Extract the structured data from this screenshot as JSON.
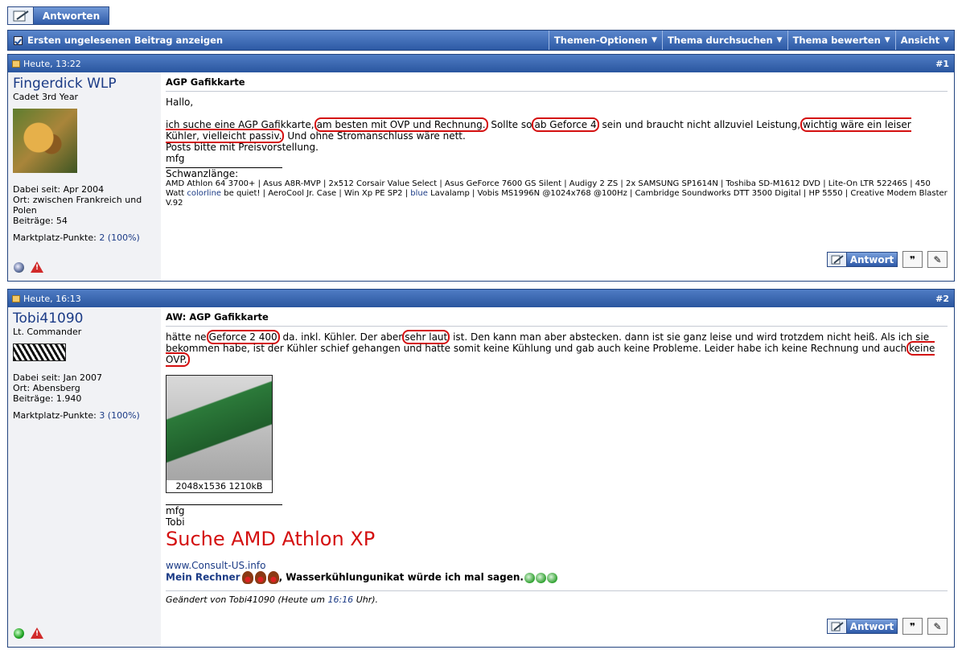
{
  "top": {
    "reply_label": "Antworten"
  },
  "toolbar": {
    "first_unread": "Ersten ungelesenen Beitrag anzeigen",
    "menus": [
      "Themen-Optionen",
      "Thema durchsuchen",
      "Thema bewerten",
      "Ansicht"
    ]
  },
  "post1": {
    "date": "Heute, 13:22",
    "number": "#1",
    "user": {
      "name": "Fingerdick WLP",
      "title": "Cadet 3rd Year",
      "joined": "Dabei seit: Apr 2004",
      "location": "Ort: zwischen Frankreich und Polen",
      "posts": "Beiträge: 54",
      "market_label": "Marktplatz-Punkte:",
      "market_value": "2 (100%)"
    },
    "title": "AGP Gafikkarte",
    "greeting": "Hallo,",
    "body": {
      "t1": "ich suche eine AGP Gafikkarte,",
      "c1": "am besten mit OVP und Rechnung.",
      "t2": "Sollte so",
      "c2": "ab Geforce 4",
      "t3": "sein und braucht nicht allzuviel Leistung,",
      "c3": "wichtig wäre ein leiser Kühler, vielleicht passiv.",
      "t4": "Und ohne Stromanschluss wäre nett."
    },
    "line2": "Posts bitte mit Preisvorstellung.",
    "line3": "mfg",
    "sig_label": "Schwanzlänge:",
    "sig_text_a": "AMD Athlon 64 3700+ | Asus A8R-MVP | 2x512 Corsair Value Select | Asus GeForce 7600 GS Silent | Audigy 2 ZS | 2x SAMSUNG SP1614N | Toshiba SD-M1612 DVD | Lite-On LTR 52246S | 450 Watt",
    "sig_colorline": "colorline",
    "sig_text_b": "be quiet! | AeroCool Jr. Case | Win Xp PE SP2 |",
    "sig_blue": "blue",
    "sig_text_c": "Lavalamp | Vobis MS1996N @1024x768 @100Hz | Cambridge Soundworks DTT 3500 Digital | HP 5550 | Creative Modem Blaster V.92",
    "btn_reply": "Antwort"
  },
  "post2": {
    "date": "Heute, 16:13",
    "number": "#2",
    "user": {
      "name": "Tobi41090",
      "title": "Lt. Commander",
      "joined": "Dabei seit: Jan 2007",
      "location": "Ort: Abensberg",
      "posts": "Beiträge: 1.940",
      "market_label": "Marktplatz-Punkte:",
      "market_value": "3 (100%)"
    },
    "title": "AW: AGP Gafikkarte",
    "body": {
      "t1": "hätte ne",
      "c1": "Geforce 2 400",
      "t2": "da. inkl. Kühler. Der aber",
      "c2": "sehr laut",
      "t3": "ist. Den kann man aber abstecken. dann ist sie ganz leise und wird trotzdem nicht heiß. Als ich sie bekommen habe, ist der Kühler schief gehangen und hatte somit keine Kühlung und gab auch keine Probleme. Leider habe ich keine Rechnung und auch",
      "c3": "keine OVP."
    },
    "image_caption": "2048x1536 1210kB",
    "sig_mfg": "mfg",
    "sig_name": "Tobi",
    "sig_big": "Suche AMD Athlon XP",
    "sig_url": "www.Consult-US.info",
    "sig_rechner": "Mein Rechner",
    "sig_wasser": ", Wasserkühlungunikat würde ich mal sagen.",
    "edited_prefix": "Geändert von Tobi41090 (Heute um",
    "edited_time": "16:16",
    "edited_suffix": "Uhr).",
    "btn_reply": "Antwort"
  }
}
